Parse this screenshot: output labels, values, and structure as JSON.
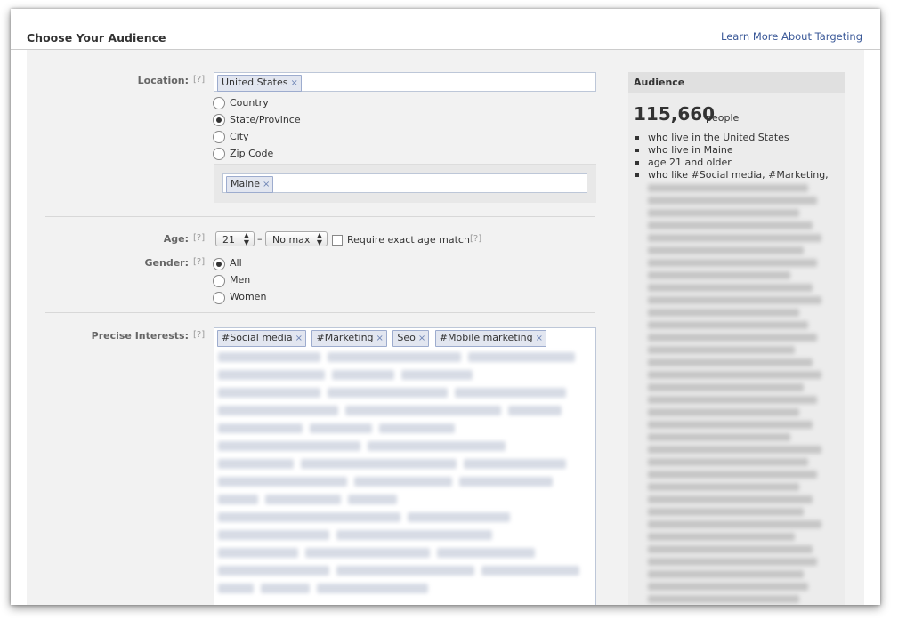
{
  "header": {
    "title": "Choose Your Audience",
    "link": "Learn More About Targeting"
  },
  "hint": "[?]",
  "location": {
    "label": "Location:",
    "token": "United States",
    "options": [
      {
        "label": "Country",
        "selected": false
      },
      {
        "label": "State/Province",
        "selected": true
      },
      {
        "label": "City",
        "selected": false
      },
      {
        "label": "Zip Code",
        "selected": false
      }
    ],
    "sub_token": "Maine"
  },
  "age": {
    "label": "Age:",
    "min": "21",
    "dash": "–",
    "max": "No max",
    "exact_label": "Require exact age match",
    "exact_checked": false
  },
  "gender": {
    "label": "Gender:",
    "options": [
      {
        "label": "All",
        "selected": true
      },
      {
        "label": "Men",
        "selected": false
      },
      {
        "label": "Women",
        "selected": false
      }
    ]
  },
  "interests": {
    "label": "Precise Interests:",
    "tokens": [
      "#Social media",
      "#Marketing",
      "Seo",
      "#Mobile marketing"
    ]
  },
  "remove_glyph": "×",
  "audience": {
    "heading": "Audience",
    "count": "115,660",
    "unit": "people",
    "criteria": [
      "who live in the United States",
      "who live in Maine",
      "age 21 and older",
      "who like #Social media, #Marketing,"
    ]
  },
  "colors": {
    "link": "#3b5998",
    "token_bg": "#e2e6f0",
    "token_border": "#9dacce",
    "panel_bg": "#f2f2f2"
  }
}
